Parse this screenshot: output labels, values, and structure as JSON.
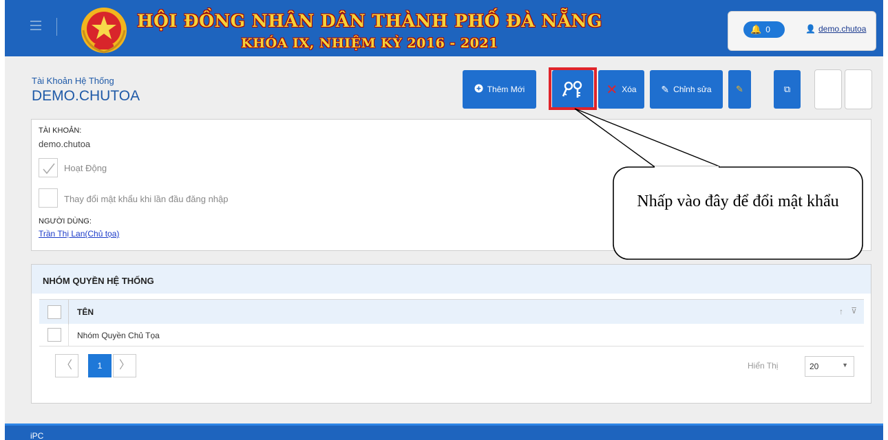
{
  "header": {
    "title_line1": "HỘI ĐỒNG NHÂN DÂN THÀNH PHỐ ĐÀ NẴNG",
    "title_line2": "KHÓA IX, NHIỆM KỲ 2016 - 2021",
    "notification_count": "0",
    "username": "demo.chutoa"
  },
  "page": {
    "subtitle": "Tài Khoản Hệ Thống",
    "title": "DEMO.CHUTOA"
  },
  "toolbar": {
    "add_label": "Thêm Mới",
    "delete_label": "Xóa",
    "edit_label": "Chỉnh sửa"
  },
  "account": {
    "account_label": "TÀI KHOẢN:",
    "account_value": "demo.chutoa",
    "active_label": "Hoạt Động",
    "active_checked": true,
    "change_password_label": "Thay đổi mật khẩu khi lần đầu đăng nhập",
    "change_password_checked": false,
    "user_label": "NGƯỜI DÙNG:",
    "user_value": "Trần Thị Lan(Chủ tọa)"
  },
  "groups": {
    "title": "NHÓM QUYỀN HỆ THỐNG",
    "column_name": "TÊN",
    "rows": [
      {
        "name": "Nhóm Quyền Chủ Tọa"
      }
    ],
    "current_page": "1",
    "page_size_label": "Hiển Thị",
    "page_size": "20"
  },
  "callout": {
    "text": "Nhấp vào đây để đổi mật khẩu"
  },
  "footer": {
    "text": "iPC"
  },
  "colors": {
    "header_blue": "#1e64be",
    "button_blue": "#1f6fcf",
    "highlight_red": "#e0242a",
    "title_gold": "#f3d23a"
  }
}
